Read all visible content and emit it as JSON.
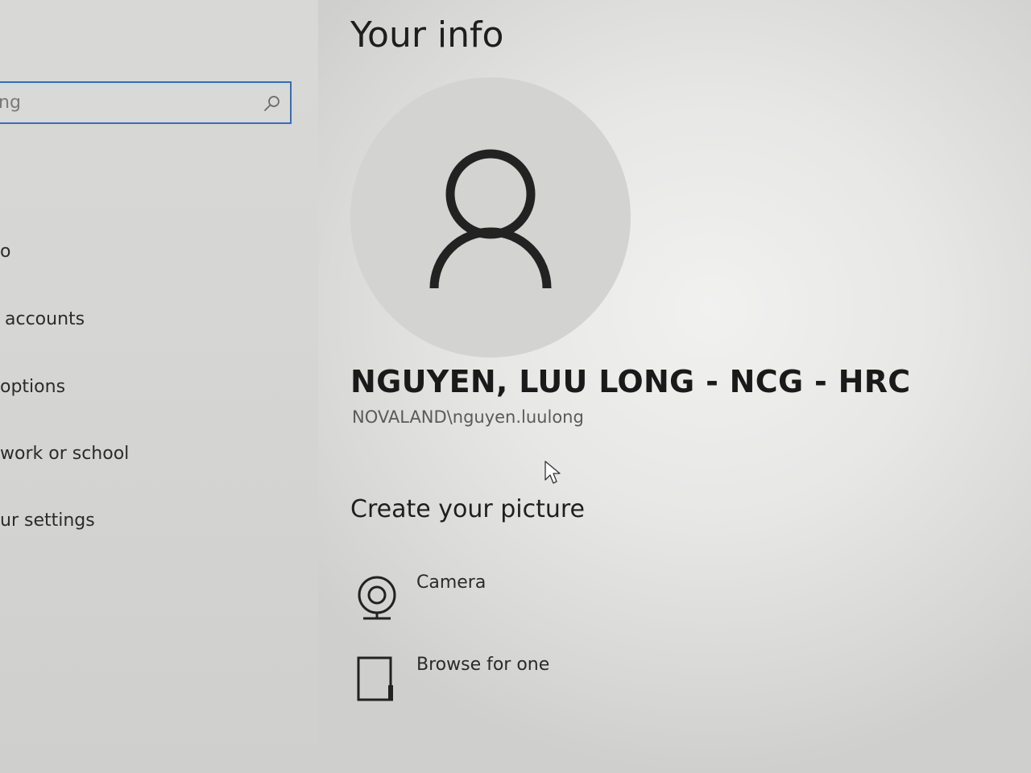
{
  "search": {
    "value": "ng"
  },
  "sidebar": {
    "items": [
      {
        "label": "o"
      },
      {
        "label": "accounts"
      },
      {
        "label": "options"
      },
      {
        "label": "work or school"
      },
      {
        "label": "ur settings"
      }
    ]
  },
  "main": {
    "title": "Your info",
    "user_name": "NGUYEN, LUU LONG - NCG - HRC",
    "user_account": "NOVALAND\\nguyen.luulong",
    "picture_heading": "Create your picture",
    "options": [
      {
        "label": "Camera",
        "icon": "camera-icon"
      },
      {
        "label": "Browse for one",
        "icon": "browse-icon"
      }
    ]
  },
  "colors": {
    "search_border": "#2f6fc0",
    "avatar_bg": "#d3d3d2",
    "icon_stroke": "#222222"
  }
}
